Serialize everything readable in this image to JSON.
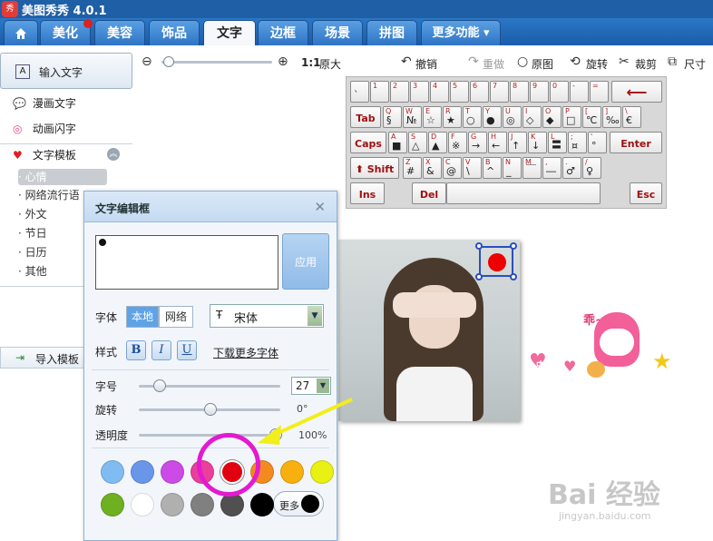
{
  "window": {
    "title": "美图秀秀 4.0.1",
    "logo_text": "秀"
  },
  "tabs": [
    {
      "label": ""
    },
    {
      "label": "美化"
    },
    {
      "label": "美容"
    },
    {
      "label": "饰品"
    },
    {
      "label": "文字"
    },
    {
      "label": "边框"
    },
    {
      "label": "场景"
    },
    {
      "label": "拼图"
    },
    {
      "label": "更多功能 ▾"
    }
  ],
  "toolbar": {
    "zoom_label": "1:1",
    "original_size": "原大",
    "undo": "撤销",
    "redo": "重做",
    "original": "原图",
    "rotate": "旋转",
    "crop": "裁剪",
    "resize": "尺寸"
  },
  "sidebar": {
    "input_text": "输入文字",
    "comic_text": "漫画文字",
    "animated_text": "动画闪字",
    "text_template": "文字模板",
    "categories": [
      "心情",
      "网络流行语",
      "外文",
      "节日",
      "日历",
      "其他"
    ],
    "import_template": "导入模板"
  },
  "keyboard": {
    "row1": [
      {
        "t": "",
        "b": "`"
      },
      {
        "t": "1",
        "b": ""
      },
      {
        "t": "2",
        "b": ""
      },
      {
        "t": "3",
        "b": ""
      },
      {
        "t": "4",
        "b": ""
      },
      {
        "t": "5",
        "b": ""
      },
      {
        "t": "6",
        "b": ""
      },
      {
        "t": "7",
        "b": ""
      },
      {
        "t": "8",
        "b": ""
      },
      {
        "t": "9",
        "b": ""
      },
      {
        "t": "0",
        "b": ""
      },
      {
        "t": "-",
        "b": ""
      },
      {
        "t": "=",
        "b": ""
      }
    ],
    "row2": [
      {
        "t": "Q",
        "b": "§"
      },
      {
        "t": "W",
        "b": "№"
      },
      {
        "t": "E",
        "b": "☆"
      },
      {
        "t": "R",
        "b": "★"
      },
      {
        "t": "T",
        "b": "○"
      },
      {
        "t": "Y",
        "b": "●"
      },
      {
        "t": "U",
        "b": "◎"
      },
      {
        "t": "I",
        "b": "◇"
      },
      {
        "t": "O",
        "b": "◆"
      },
      {
        "t": "P",
        "b": "□"
      },
      {
        "t": "[",
        "b": "℃"
      },
      {
        "t": "]",
        "b": "‰"
      },
      {
        "t": "\\",
        "b": "€"
      }
    ],
    "row3": [
      {
        "t": "A",
        "b": "■"
      },
      {
        "t": "S",
        "b": "△"
      },
      {
        "t": "D",
        "b": "▲"
      },
      {
        "t": "F",
        "b": "※"
      },
      {
        "t": "G",
        "b": "→"
      },
      {
        "t": "H",
        "b": "←"
      },
      {
        "t": "J",
        "b": "↑"
      },
      {
        "t": "K",
        "b": "↓"
      },
      {
        "t": "L",
        "b": "〓"
      },
      {
        "t": ";",
        "b": "¤"
      },
      {
        "t": "'",
        "b": "°"
      }
    ],
    "row4": [
      {
        "t": "Z",
        "b": "#"
      },
      {
        "t": "X",
        "b": "&"
      },
      {
        "t": "C",
        "b": "@"
      },
      {
        "t": "V",
        "b": "\\"
      },
      {
        "t": "B",
        "b": "^"
      },
      {
        "t": "N",
        "b": "_"
      },
      {
        "t": "M",
        "b": "￣"
      },
      {
        "t": ",",
        "b": "―"
      },
      {
        "t": ".",
        "b": "♂"
      },
      {
        "t": "/",
        "b": "♀"
      }
    ],
    "tab": "Tab",
    "caps": "Caps",
    "shift": "Shift",
    "enter": "Enter",
    "ins": "Ins",
    "del": "Del",
    "esc": "Esc"
  },
  "dialog": {
    "title": "文字编辑框",
    "apply": "应用",
    "font_label": "字体",
    "local": "本地",
    "network": "网络",
    "font_name": "宋体",
    "style_label": "样式",
    "bold": "B",
    "italic": "I",
    "underline": "U",
    "download_fonts": "下载更多字体",
    "size_label": "字号",
    "size_value": "27",
    "rotate_label": "旋转",
    "rotate_value": "0°",
    "opacity_label": "透明度",
    "opacity_value": "100%",
    "more": "更多",
    "swatches_row1": [
      "#7fbcf2",
      "#6a96ea",
      "#cc4ae6",
      "#ea3f9a",
      "#e00010",
      "#f28a20",
      "#f8b010",
      "#e8f014"
    ],
    "swatches_row2": [
      "#6fb020",
      "#ffffff",
      "#b0b0b0",
      "#808080",
      "#505050",
      "#000000"
    ]
  },
  "sticker": {
    "badge": "中",
    "word": "乖~"
  },
  "watermark": {
    "big": "Bai 经验",
    "small": "jingyan.baidu.com"
  }
}
